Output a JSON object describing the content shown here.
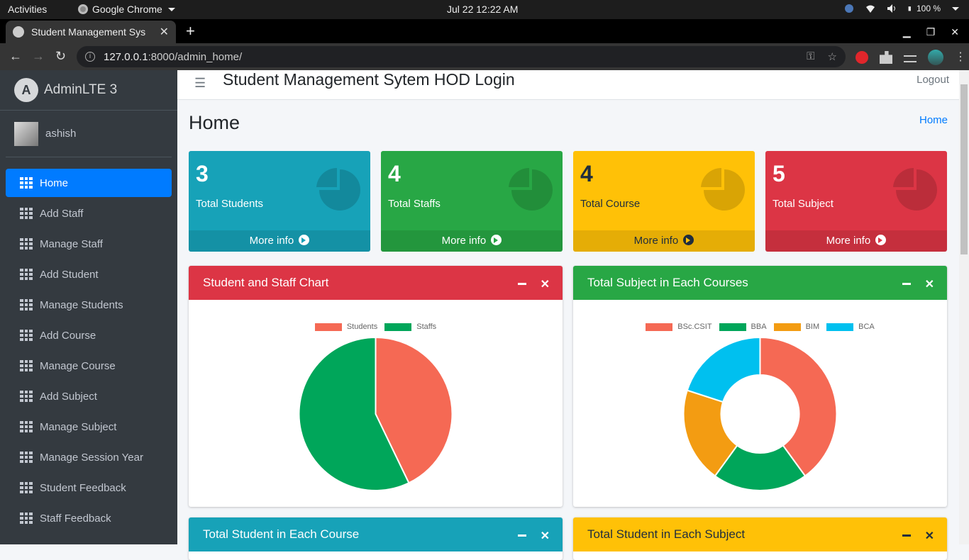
{
  "os_bar": {
    "activities": "Activities",
    "app_name": "Google Chrome",
    "datetime": "Jul 22  12:22 AM",
    "battery": "100 %"
  },
  "browser": {
    "tab_title": "Student Management Sys",
    "tab_close": "✕",
    "new_tab": "+",
    "url_host": "127.0.0.1",
    "url_path": ":8000/admin_home/"
  },
  "sidebar": {
    "brand": "AdminLTE 3",
    "brand_logo": "A",
    "username": "ashish",
    "items": [
      {
        "label": "Home",
        "active": true
      },
      {
        "label": "Add Staff"
      },
      {
        "label": "Manage Staff"
      },
      {
        "label": "Add Student"
      },
      {
        "label": "Manage Students"
      },
      {
        "label": "Add Course"
      },
      {
        "label": "Manage Course"
      },
      {
        "label": "Add Subject"
      },
      {
        "label": "Manage Subject"
      },
      {
        "label": "Manage Session Year"
      },
      {
        "label": "Student Feedback"
      },
      {
        "label": "Staff Feedback"
      }
    ]
  },
  "header": {
    "title": "Student Management Sytem HOD Login",
    "logout": "Logout"
  },
  "content": {
    "title": "Home",
    "breadcrumb": "Home"
  },
  "stat_boxes": [
    {
      "value": "3",
      "label": "Total Students",
      "more": "More info",
      "color": "#17a2b8"
    },
    {
      "value": "4",
      "label": "Total Staffs",
      "more": "More info",
      "color": "#28a745"
    },
    {
      "value": "4",
      "label": "Total Course",
      "more": "More info",
      "color": "#ffc107"
    },
    {
      "value": "5",
      "label": "Total Subject",
      "more": "More info",
      "color": "#dc3545"
    }
  ],
  "cards": [
    {
      "title": "Student and Staff Chart",
      "color": "#dc3545"
    },
    {
      "title": "Total Subject in Each Courses",
      "color": "#28a745"
    },
    {
      "title": "Total Student in Each Course",
      "color": "#17a2b8"
    },
    {
      "title": "Total Student in Each Subject",
      "color": "#ffc107"
    }
  ],
  "chart_data": [
    {
      "type": "pie",
      "title": "Student and Staff Chart",
      "categories": [
        "Students",
        "Staffs"
      ],
      "values": [
        3,
        4
      ],
      "colors": [
        "#f56954",
        "#00a65a"
      ],
      "legend": "top"
    },
    {
      "type": "pie",
      "title": "Total Subject in Each Courses",
      "categories": [
        "BSc.CSIT",
        "BBA",
        "BIM",
        "BCA"
      ],
      "values": [
        2,
        1,
        1,
        1
      ],
      "colors": [
        "#f56954",
        "#00a65a",
        "#f39c12",
        "#00c0ef"
      ],
      "donut": true,
      "legend": "top"
    }
  ]
}
